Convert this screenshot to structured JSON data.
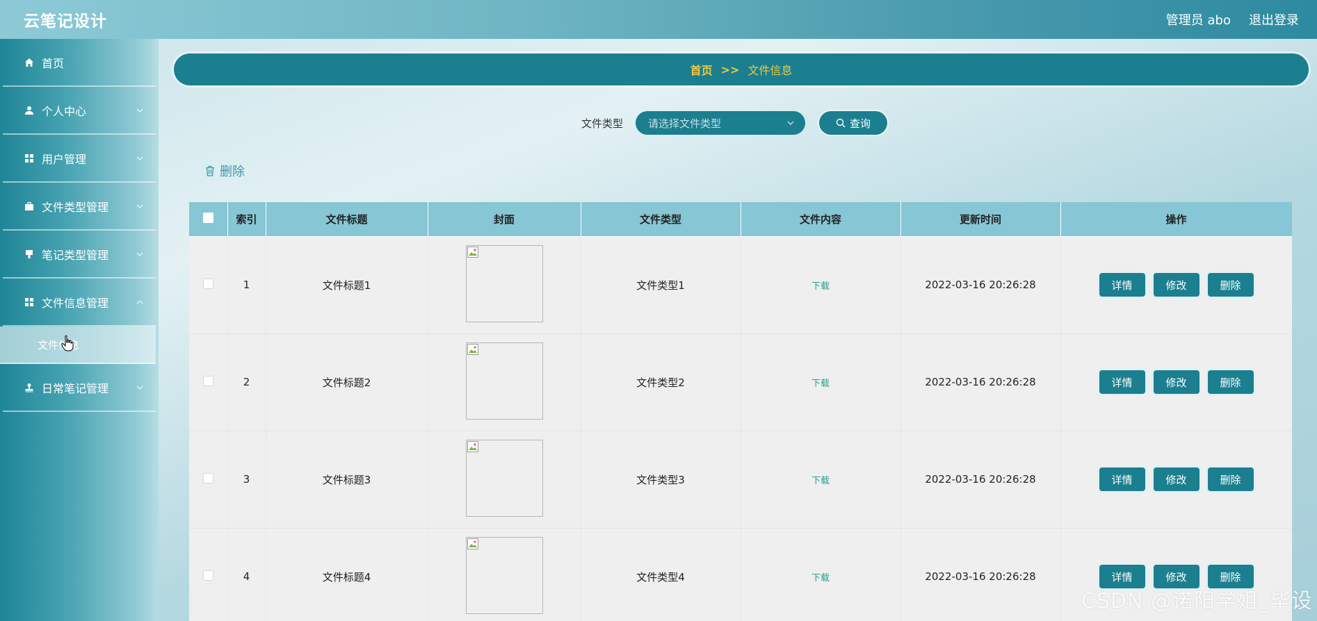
{
  "header": {
    "app_title": "云笔记设计",
    "user_label": "管理员 abo",
    "logout_label": "退出登录"
  },
  "sidebar": {
    "items": [
      {
        "label": "首页",
        "icon": "home-icon"
      },
      {
        "label": "个人中心",
        "icon": "user-icon"
      },
      {
        "label": "用户管理",
        "icon": "grid-icon"
      },
      {
        "label": "文件类型管理",
        "icon": "briefcase-icon"
      },
      {
        "label": "笔记类型管理",
        "icon": "brush-icon"
      },
      {
        "label": "文件信息管理",
        "icon": "grid-icon"
      },
      {
        "label": "日常笔记管理",
        "icon": "stamp-icon"
      }
    ],
    "sub_item": {
      "label": "文件信息"
    }
  },
  "breadcrumb": {
    "home": "首页",
    "sep": ">>",
    "current": "文件信息"
  },
  "search": {
    "label": "文件类型",
    "placeholder": "请选择文件类型",
    "button": "查询"
  },
  "actions": {
    "bulk_delete": "删除"
  },
  "table": {
    "headers": [
      "索引",
      "文件标题",
      "封面",
      "文件类型",
      "文件内容",
      "更新时间",
      "操作"
    ],
    "rows": [
      {
        "index": "1",
        "title": "文件标题1",
        "type": "文件类型1",
        "content": "下载",
        "updated": "2022-03-16 20:26:28"
      },
      {
        "index": "2",
        "title": "文件标题2",
        "type": "文件类型2",
        "content": "下载",
        "updated": "2022-03-16 20:26:28"
      },
      {
        "index": "3",
        "title": "文件标题3",
        "type": "文件类型3",
        "content": "下载",
        "updated": "2022-03-16 20:26:28"
      },
      {
        "index": "4",
        "title": "文件标题4",
        "type": "文件类型4",
        "content": "下载",
        "updated": "2022-03-16 20:26:28"
      }
    ],
    "row_buttons": {
      "detail": "详情",
      "edit": "修改",
      "delete": "删除"
    }
  },
  "watermark": "CSDN @诺阳学姐_毕设",
  "colors": {
    "accent": "#1b7f8f",
    "header_row": "#87c6d4",
    "breadcrumb_text": "#f5c842",
    "link": "#2aa08f"
  }
}
